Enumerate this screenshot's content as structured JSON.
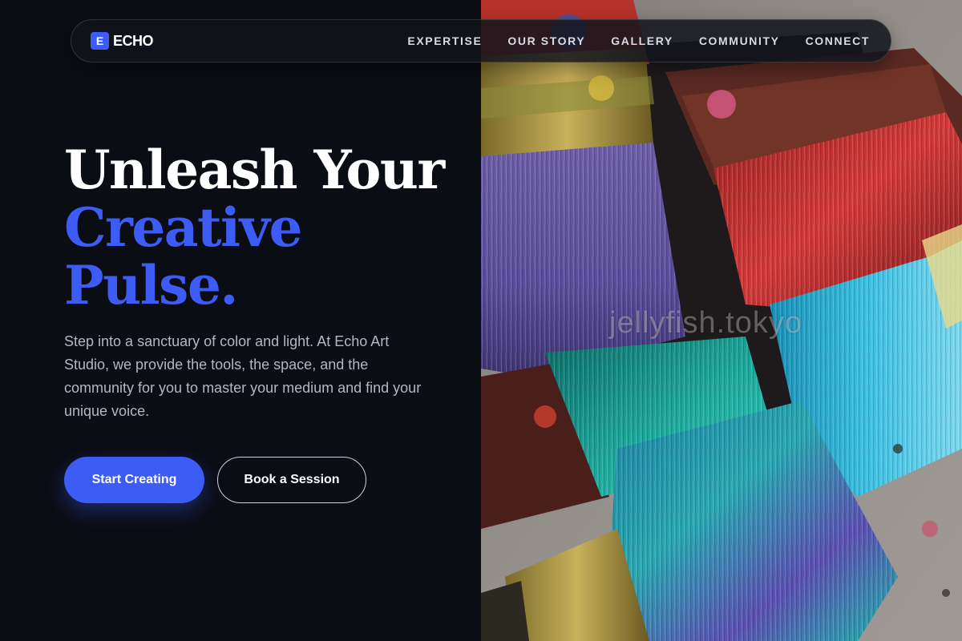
{
  "brand": {
    "mark": "E",
    "name": "ECHO",
    "accent_color": "#3d5cf5"
  },
  "nav": {
    "links": [
      "EXPERTISE",
      "OUR STORY",
      "GALLERY",
      "COMMUNITY",
      "CONNECT"
    ]
  },
  "hero": {
    "headline_line1": "Unleash Your",
    "headline_line2": "Creative",
    "headline_line3": "Pulse.",
    "lede": "Step into a sanctuary of color and light. At Echo Art Studio, we provide the tools, the space, and the community for you to master your medium and find your unique voice.",
    "primary_cta": "Start Creating",
    "secondary_cta": "Book a Session"
  },
  "image": {
    "subject": "paint-brushes-photo",
    "watermark": "jellyfish.tokyo"
  },
  "colors": {
    "background": "#0b0d14",
    "accent": "#3d5cf5",
    "text": "#ffffff",
    "muted_text": "#b4b7c0"
  }
}
